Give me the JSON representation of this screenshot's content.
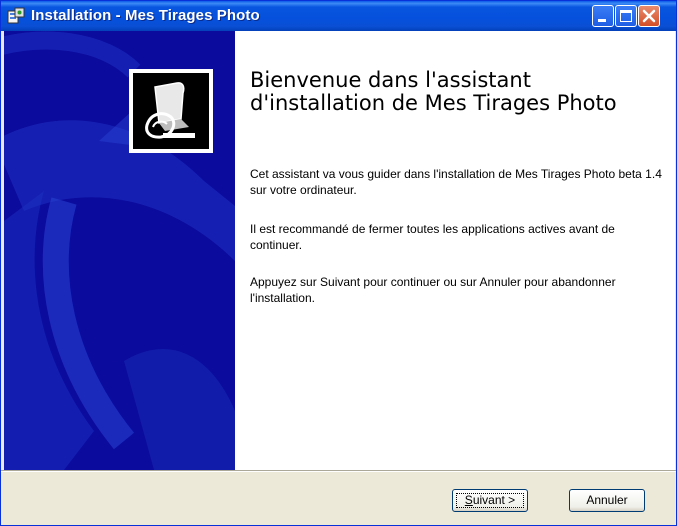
{
  "window": {
    "title": "Installation - Mes Tirages Photo",
    "icon": "installer-icon",
    "controls": {
      "minimize": "minimize-icon",
      "maximize": "maximize-icon",
      "close": "close-icon"
    }
  },
  "content": {
    "heading": "Bienvenue dans l'assistant d'installation de Mes Tirages Photo",
    "paragraphs": [
      "Cet assistant va vous guider dans l'installation de Mes Tirages Photo beta 1.4 sur votre ordinateur.",
      "Il est recommandé de fermer toutes les applications actives avant de continuer.",
      "Appuyez sur Suivant pour continuer ou sur Annuler pour abandonner l'installation."
    ]
  },
  "buttons": {
    "next_first": "S",
    "next_rest": "uivant >",
    "cancel": "Annuler"
  },
  "colors": {
    "titlebar": "#0550dc",
    "side_panel": "#0a0a9c",
    "dialog": "#ece9d8"
  }
}
